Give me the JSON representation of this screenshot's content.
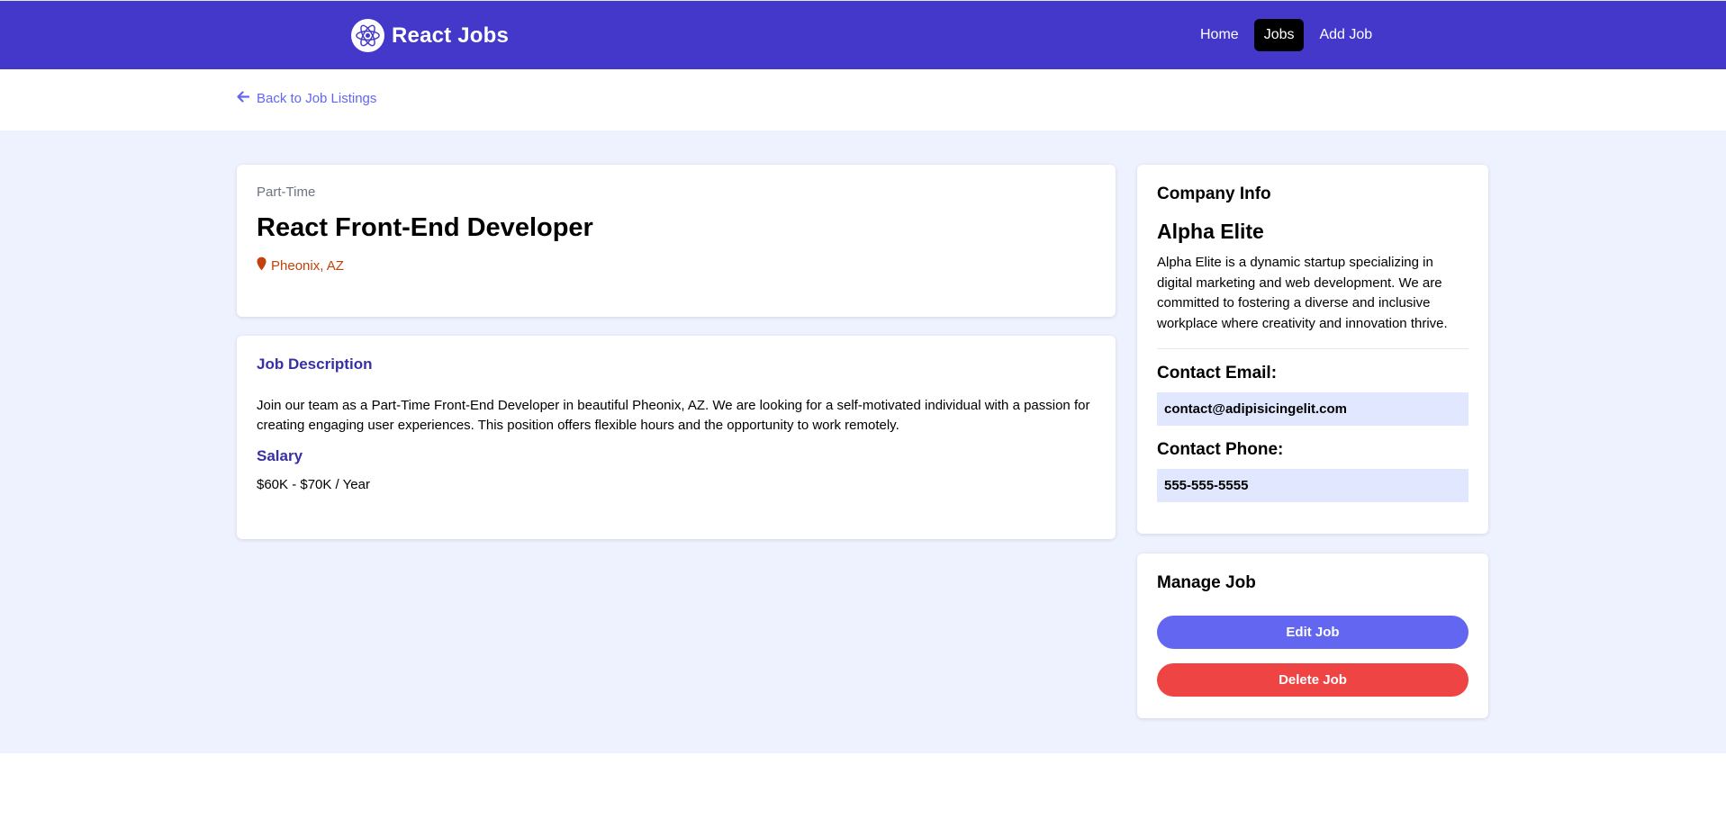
{
  "nav": {
    "brand": "React Jobs",
    "links": [
      {
        "label": "Home"
      },
      {
        "label": "Jobs"
      },
      {
        "label": "Add Job"
      }
    ]
  },
  "back_link": "Back to Job Listings",
  "job": {
    "type": "Part-Time",
    "title": "React Front-End Developer",
    "location": "Pheonix, AZ",
    "description_heading": "Job Description",
    "description": "Join our team as a Part-Time Front-End Developer in beautiful Pheonix, AZ. We are looking for a self-motivated individual with a passion for creating engaging user experiences. This position offers flexible hours and the opportunity to work remotely.",
    "salary_heading": "Salary",
    "salary": "$60K - $70K / Year"
  },
  "company": {
    "section_title": "Company Info",
    "name": "Alpha Elite",
    "description": "Alpha Elite is a dynamic startup specializing in digital marketing and web development. We are committed to fostering a diverse and inclusive workplace where creativity and innovation thrive.",
    "email_label": "Contact Email:",
    "email": "contact@adipisicingelit.com",
    "phone_label": "Contact Phone:",
    "phone": "555-555-5555"
  },
  "manage": {
    "section_title": "Manage Job",
    "edit_label": "Edit Job",
    "delete_label": "Delete Job"
  },
  "colors": {
    "navbar": "#4338ca",
    "accent": "#6366f1",
    "danger": "#ef4444",
    "location": "#c2410c",
    "background": "#eef2ff",
    "contact_box": "#e0e7ff"
  },
  "icons": {
    "brand": "react-logo-icon",
    "back": "arrow-left-icon",
    "location": "map-marker-icon"
  }
}
